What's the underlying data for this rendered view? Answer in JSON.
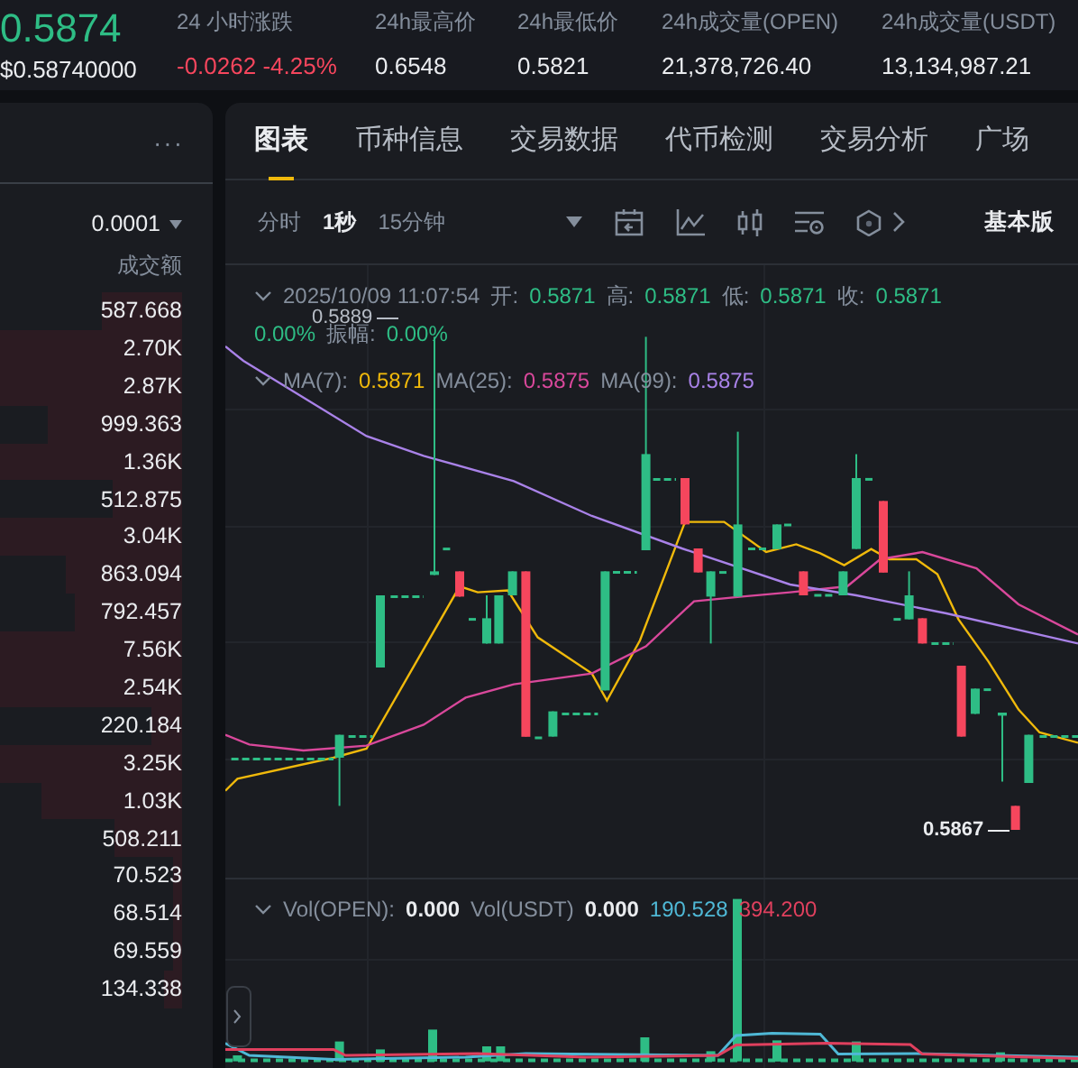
{
  "ticker": {
    "price": "0.5874",
    "usd_price": "$0.58740000"
  },
  "stats": [
    {
      "label": "24 小时涨跌",
      "value": "-0.0262 -4.25%",
      "kind": "change"
    },
    {
      "label": "24h最高价",
      "value": "0.6548",
      "kind": "plain"
    },
    {
      "label": "24h最低价",
      "value": "0.5821",
      "kind": "plain"
    },
    {
      "label": "24h成交量(OPEN)",
      "value": "21,378,726.40",
      "kind": "plain"
    },
    {
      "label": "24h成交量(USDT)",
      "value": "13,134,987.21",
      "kind": "plain"
    }
  ],
  "order_book": {
    "more": "···",
    "precision": "0.0001",
    "column": "成交额",
    "rows": [
      {
        "value": "587.668"
      },
      {
        "value": "2.70K"
      },
      {
        "value": "2.87K"
      },
      {
        "value": "999.363"
      },
      {
        "value": "1.36K"
      },
      {
        "value": "512.875"
      },
      {
        "value": "3.04K"
      },
      {
        "value": "863.094"
      },
      {
        "value": "792.457"
      },
      {
        "value": "7.56K"
      },
      {
        "value": "2.54K"
      },
      {
        "value": "220.184"
      },
      {
        "value": "3.25K"
      },
      {
        "value": "1.03K"
      },
      {
        "value": "508.211"
      },
      {
        "value": "70.523"
      },
      {
        "value": "68.514"
      },
      {
        "value": "69.559"
      },
      {
        "value": "134.338"
      }
    ]
  },
  "tabs": [
    {
      "label": "图表",
      "selected": true
    },
    {
      "label": "币种信息",
      "selected": false
    },
    {
      "label": "交易数据",
      "selected": false
    },
    {
      "label": "代币检测",
      "selected": false
    },
    {
      "label": "交易分析",
      "selected": false
    },
    {
      "label": "广场",
      "selected": false
    }
  ],
  "intervals": [
    {
      "label": "分时",
      "selected": false
    },
    {
      "label": "1秒",
      "selected": true
    },
    {
      "label": "15分钟",
      "selected": false
    }
  ],
  "version_label": "基本版",
  "ohlc": {
    "date": "2025/10/09 11:07:54",
    "fields": [
      {
        "label": "开:",
        "value": "0.5871"
      },
      {
        "label": "高:",
        "value": "0.5871"
      },
      {
        "label": "低:",
        "value": "0.5871"
      },
      {
        "label": "收:",
        "value": "0.5871"
      }
    ],
    "change": "0.00%",
    "amplitude_label": "振幅:",
    "amplitude": "0.00%"
  },
  "moving_averages": [
    {
      "label": "MA(7):",
      "value": "0.5871",
      "color": "#f0b90b"
    },
    {
      "label": "MA(25):",
      "value": "0.5875",
      "color": "#d9489b"
    },
    {
      "label": "MA(99):",
      "value": "0.5875",
      "color": "#a982e8"
    }
  ],
  "chart_labels": {
    "high": "0.5889",
    "low": "0.5867"
  },
  "volume": {
    "items": [
      {
        "label": "Vol(OPEN):",
        "value": "0.000"
      },
      {
        "label": "Vol(USDT)",
        "value": "0.000"
      }
    ],
    "averages": [
      {
        "value": "190.528",
        "color": "#4fb8d6"
      },
      {
        "value": "394.200",
        "color": "#e0405e"
      }
    ]
  }
}
